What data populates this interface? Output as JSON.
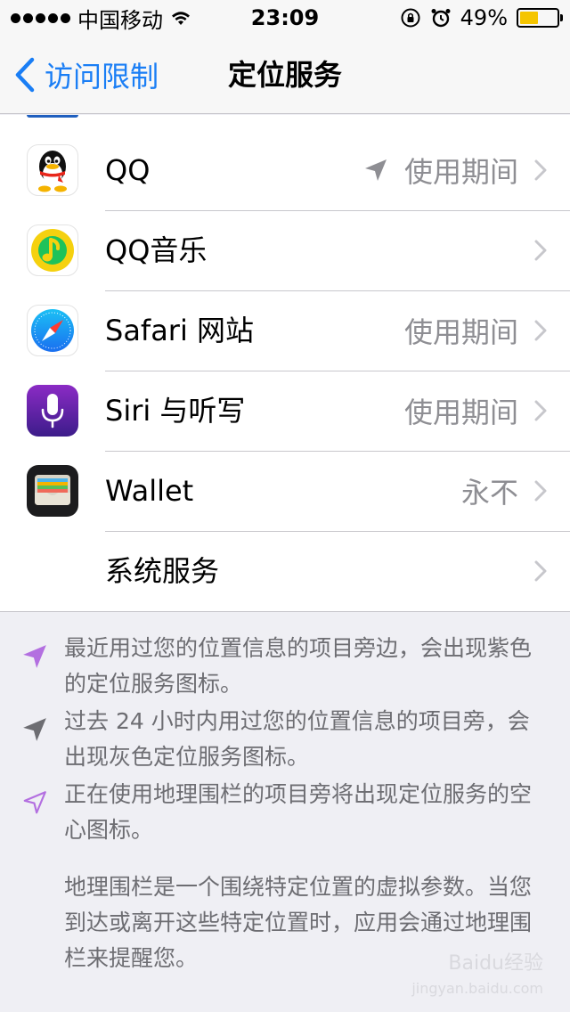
{
  "status_bar": {
    "carrier": "中国移动",
    "time": "23:09",
    "battery": "49%",
    "battery_level": 0.49,
    "icons": [
      "signal-dots-icon",
      "wifi-icon",
      "orientation-lock-icon",
      "alarm-icon",
      "battery-icon"
    ]
  },
  "nav": {
    "back_label": "访问限制",
    "title": "定位服务"
  },
  "apps": [
    {
      "name": "QQ",
      "status": "使用期间",
      "location_icon": "gray",
      "icon": "qq-icon"
    },
    {
      "name": "QQ音乐",
      "status": "",
      "location_icon": "none",
      "icon": "qq-music-icon"
    },
    {
      "name": "Safari 网站",
      "status": "使用期间",
      "location_icon": "none",
      "icon": "safari-icon"
    },
    {
      "name": "Siri 与听写",
      "status": "使用期间",
      "location_icon": "none",
      "icon": "siri-icon"
    },
    {
      "name": "Wallet",
      "status": "永不",
      "location_icon": "none",
      "icon": "wallet-icon"
    },
    {
      "name": "系统服务",
      "status": "",
      "location_icon": "none",
      "icon": "none"
    }
  ],
  "legend": [
    {
      "text": "最近用过您的位置信息的项目旁边，会出现紫色的定位服务图标。",
      "icon": "purple-location-arrow-icon",
      "color": "#b36fe0"
    },
    {
      "text": "过去 24 小时内用过您的位置信息的项目旁，会出现灰色定位服务图标。",
      "icon": "gray-location-arrow-icon",
      "color": "#8e8e93"
    },
    {
      "text": "正在使用地理围栏的项目旁将出现定位服务的空心图标。",
      "icon": "hollow-location-arrow-icon",
      "color": "#b36fe0"
    }
  ],
  "geofence_note": "地理围栏是一个围绕特定位置的虚拟参数。当您到达或离开这些特定位置时，应用会通过地理围栏来提醒您。",
  "watermark": {
    "line1": "Baidu经验",
    "line2": "jingyan.baidu.com"
  },
  "colors": {
    "accent": "#1a7ef5",
    "battery": "#f5c500"
  }
}
